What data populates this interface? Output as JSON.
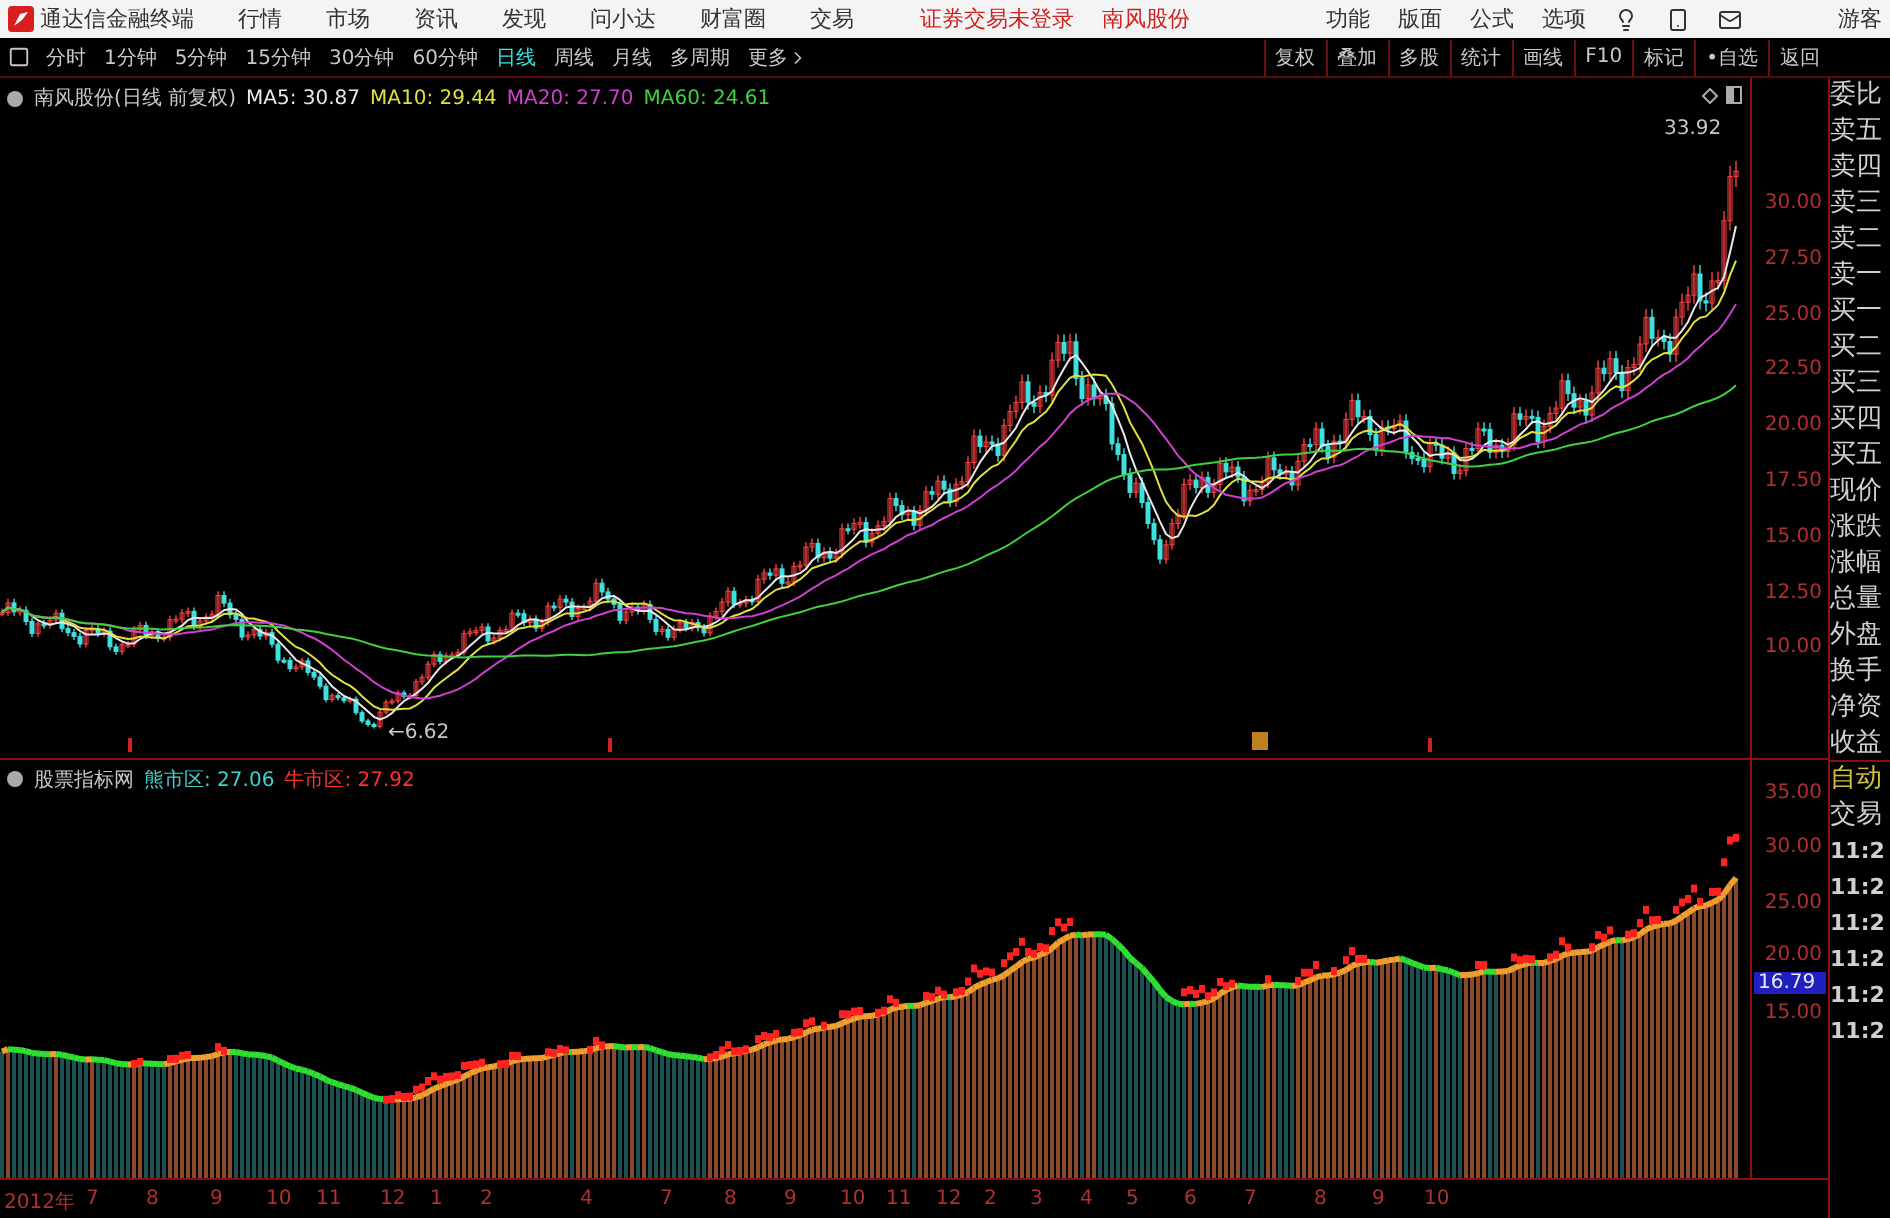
{
  "app": {
    "title": "通达信金融终端",
    "menu": [
      "行情",
      "市场",
      "资讯",
      "发现",
      "问小达",
      "财富圈",
      "交易"
    ],
    "notice": "证券交易未登录",
    "stock": "南风股份",
    "tools": [
      "功能",
      "版面",
      "公式",
      "选项"
    ],
    "user": "游客"
  },
  "periods": [
    {
      "label": "分时",
      "selected": false
    },
    {
      "label": "1分钟",
      "selected": false
    },
    {
      "label": "5分钟",
      "selected": false
    },
    {
      "label": "15分钟",
      "selected": false
    },
    {
      "label": "30分钟",
      "selected": false
    },
    {
      "label": "60分钟",
      "selected": false
    },
    {
      "label": "日线",
      "selected": true
    },
    {
      "label": "周线",
      "selected": false
    },
    {
      "label": "月线",
      "selected": false
    },
    {
      "label": "多周期",
      "selected": false
    },
    {
      "label": "更多",
      "selected": false
    }
  ],
  "actions": [
    "复权",
    "叠加",
    "多股",
    "统计",
    "画线",
    "F10",
    "标记",
    "•自选",
    "返回"
  ],
  "main_chart": {
    "title": "南风股份(日线 前复权)",
    "ma": [
      {
        "label": "MA5: 30.87",
        "color": "#e8e8e8"
      },
      {
        "label": "MA10: 29.44",
        "color": "#e0e040"
      },
      {
        "label": "MA20: 27.70",
        "color": "#d040d0"
      },
      {
        "label": "MA60: 24.61",
        "color": "#40d040"
      }
    ],
    "price_labels": [
      "30.00",
      "27.50",
      "25.00",
      "22.50",
      "20.00",
      "17.50",
      "15.00",
      "12.50",
      "10.00"
    ],
    "high_label": "33.92",
    "low_label": "←6.62"
  },
  "indicator": {
    "title": "股票指标网",
    "legend": [
      {
        "label": "熊市区: 27.06",
        "color": "#40d0d0"
      },
      {
        "label": "牛市区: 27.92",
        "color": "#ff3030"
      }
    ],
    "axis_labels": [
      "35.00",
      "30.00",
      "25.00",
      "20.00",
      "15.00"
    ],
    "current": "16.79"
  },
  "time_axis": [
    "2012年",
    "7",
    "8",
    "9",
    "10",
    "11",
    "12",
    "1",
    "2",
    "4",
    "7",
    "8",
    "9",
    "10",
    "11",
    "12",
    "2",
    "3",
    "4",
    "5",
    "6",
    "7",
    "8",
    "9",
    "10"
  ],
  "quote_panel": {
    "labels": [
      "委比",
      "卖五",
      "卖四",
      "卖三",
      "卖二",
      "卖一",
      "买一",
      "买二",
      "买三",
      "买四",
      "买五",
      "现价",
      "涨跌",
      "涨幅",
      "总量",
      "外盘",
      "换手",
      "净资",
      "收益"
    ],
    "trade_header": [
      "自动",
      "交易"
    ],
    "times": [
      "11:2",
      "11:2",
      "11:2",
      "11:2",
      "11:2",
      "11:2"
    ]
  }
}
